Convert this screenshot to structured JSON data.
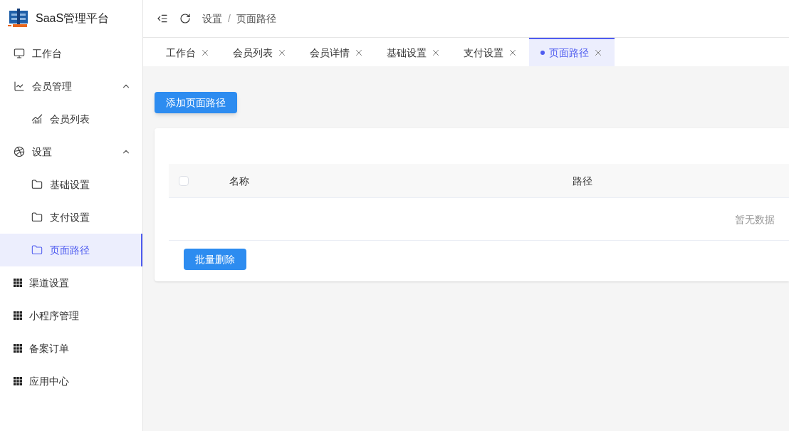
{
  "app": {
    "title": "SaaS管理平台"
  },
  "sidebar": {
    "items": [
      {
        "label": "工作台",
        "kind": "monitor",
        "selected": false
      },
      {
        "label": "会员管理",
        "kind": "chart",
        "expanded": true,
        "children": [
          {
            "label": "会员列表",
            "kind": "wave",
            "selected": false
          }
        ]
      },
      {
        "label": "设置",
        "kind": "ball",
        "expanded": true,
        "children": [
          {
            "label": "基础设置",
            "kind": "folder",
            "selected": false
          },
          {
            "label": "支付设置",
            "kind": "folder",
            "selected": false
          },
          {
            "label": "页面路径",
            "kind": "folder",
            "selected": true
          }
        ]
      },
      {
        "label": "渠道设置",
        "kind": "grid",
        "selected": false
      },
      {
        "label": "小程序管理",
        "kind": "grid",
        "selected": false
      },
      {
        "label": "备案订单",
        "kind": "grid",
        "selected": false
      },
      {
        "label": "应用中心",
        "kind": "grid",
        "selected": false
      }
    ]
  },
  "breadcrumb": [
    "设置",
    "页面路径"
  ],
  "breadcrumb_separator": "/",
  "tabs": [
    {
      "label": "工作台",
      "selected": false
    },
    {
      "label": "会员列表",
      "selected": false
    },
    {
      "label": "会员详情",
      "selected": false
    },
    {
      "label": "基础设置",
      "selected": false
    },
    {
      "label": "支付设置",
      "selected": false
    },
    {
      "label": "页面路径",
      "selected": true
    }
  ],
  "add_button": "添加页面路径",
  "table": {
    "select_all_checked": false,
    "columns": [
      "名称",
      "路径"
    ],
    "empty_text": "暂无数据"
  },
  "batch_delete_button": "批量删除"
}
